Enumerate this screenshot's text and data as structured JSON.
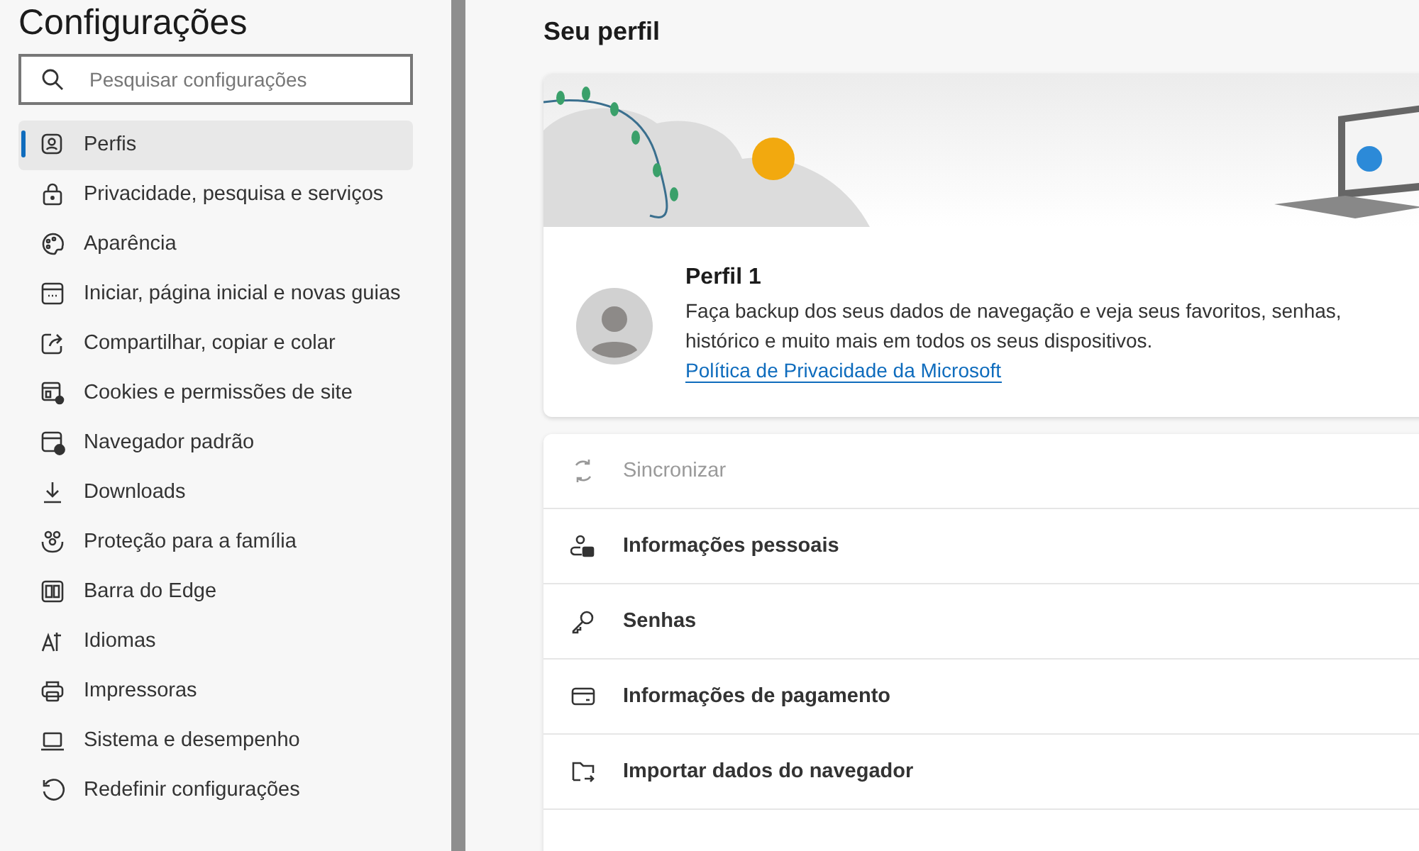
{
  "sidebar": {
    "title": "Configurações",
    "search": {
      "placeholder": "Pesquisar configurações"
    },
    "items": [
      {
        "label": "Perfis",
        "selected": true
      },
      {
        "label": "Privacidade, pesquisa e serviços",
        "selected": false
      },
      {
        "label": "Aparência",
        "selected": false
      },
      {
        "label": "Iniciar, página inicial e novas guias",
        "selected": false
      },
      {
        "label": "Compartilhar, copiar e colar",
        "selected": false
      },
      {
        "label": "Cookies e permissões de site",
        "selected": false
      },
      {
        "label": "Navegador padrão",
        "selected": false
      },
      {
        "label": "Downloads",
        "selected": false
      },
      {
        "label": "Proteção para a família",
        "selected": false
      },
      {
        "label": "Barra do Edge",
        "selected": false
      },
      {
        "label": "Idiomas",
        "selected": false
      },
      {
        "label": "Impressoras",
        "selected": false
      },
      {
        "label": "Sistema e desempenho",
        "selected": false
      },
      {
        "label": "Redefinir configurações",
        "selected": false
      }
    ]
  },
  "main": {
    "heading": "Seu perfil",
    "profile": {
      "name": "Perfil 1",
      "description": "Faça backup dos seus dados de navegação e veja seus favoritos, senhas, histórico e muito mais em todos os seus dispositivos.",
      "link": "Política de Privacidade da Microsoft"
    },
    "rows": [
      {
        "label": "Sincronizar",
        "disabled": true
      },
      {
        "label": "Informações pessoais",
        "disabled": false
      },
      {
        "label": "Senhas",
        "disabled": false
      },
      {
        "label": "Informações de pagamento",
        "disabled": false
      },
      {
        "label": "Importar dados do navegador",
        "disabled": false
      }
    ]
  }
}
